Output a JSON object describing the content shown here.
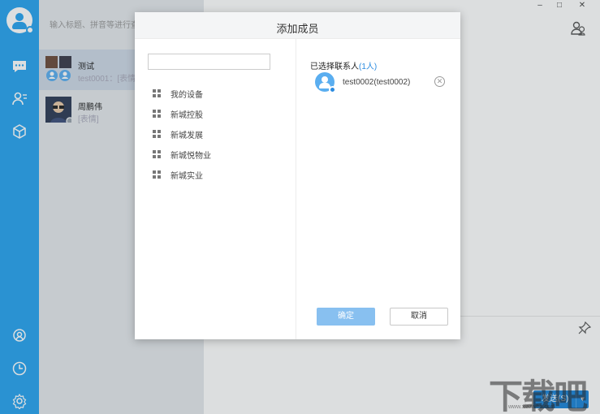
{
  "nav": {
    "icons": [
      "user-avatar",
      "chat-icon",
      "contacts-icon",
      "apps-icon",
      "location-icon",
      "clock-icon",
      "settings-icon"
    ],
    "accent": "#27a3f0"
  },
  "search": {
    "placeholder": "输入标题、拼音等进行查"
  },
  "conversations": [
    {
      "title": "测试",
      "subtitle": "test0001：[表情]"
    },
    {
      "title": "周鹏伟",
      "subtitle": "[表情]"
    }
  ],
  "window_controls": {
    "minimize": "–",
    "maximize": "□",
    "close": "✕"
  },
  "chat": {
    "send_label": "发送(S)",
    "send_arrow": "▼"
  },
  "modal": {
    "title": "添加成员",
    "search_value": "",
    "tree": [
      {
        "label": "我的设备"
      },
      {
        "label": "新城控股"
      },
      {
        "label": "新城发展"
      },
      {
        "label": "新城悦物业"
      },
      {
        "label": "新城实业"
      }
    ],
    "selected_heading": "已选择联系人",
    "selected_count": "(1人)",
    "selected": [
      {
        "name": "test0002(test0002)",
        "remove": "✕"
      }
    ],
    "ok_label": "确定",
    "cancel_label": "取消"
  },
  "watermark": {
    "text": "下载吧",
    "sub": "www.xiazaiba.com"
  }
}
